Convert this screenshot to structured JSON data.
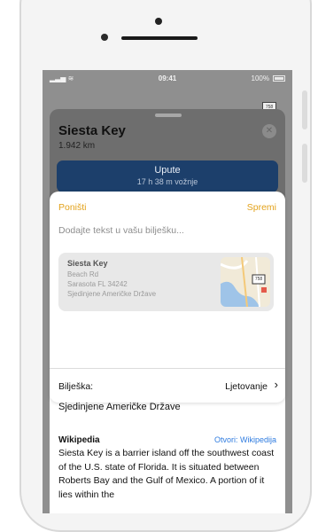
{
  "status_bar": {
    "time": "09:41",
    "battery": "100%"
  },
  "place": {
    "name": "Siesta Key",
    "distance": "1.942 km",
    "map_badge": "758"
  },
  "directions": {
    "label": "Upute",
    "duration": "17 h 38 m vožnje"
  },
  "note_sheet": {
    "cancel_label": "Poništi",
    "save_label": "Spremi",
    "note_placeholder": "Dodajte tekst u vašu bilješku...",
    "location": {
      "title": "Siesta Key",
      "lines": [
        "Beach Rd",
        "Sarasota FL 34242",
        "Sjedinjene Američke Države"
      ],
      "thumb_badge": "758"
    },
    "note_label": "Bilješka:",
    "note_value": "Ljetovanje"
  },
  "details": {
    "country": "Sjedinjene Američke Države",
    "wiki_source": "Wikipedia",
    "wiki_open": "Otvori: Wikipedija",
    "wiki_text": "Siesta Key is a barrier island off the southwest coast of the U.S. state of Florida. It is situated between Roberts Bay and the Gulf of Mexico. A portion of it lies within the"
  },
  "colors": {
    "accent": "#e3a21a",
    "link": "#2f7ce0",
    "directions_bg": "#1c3f6b"
  }
}
